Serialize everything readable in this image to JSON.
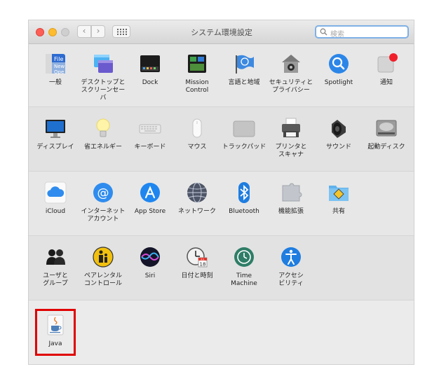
{
  "window": {
    "title": "システム環境設定",
    "search_placeholder": "検索",
    "nav": {
      "back": "‹",
      "forward": "›"
    }
  },
  "sections": [
    {
      "items": [
        {
          "label": "一般",
          "icon": "general-icon"
        },
        {
          "label": "デスクトップと\nスクリーンセーバ",
          "icon": "desktop-screensaver-icon"
        },
        {
          "label": "Dock",
          "icon": "dock-icon"
        },
        {
          "label": "Mission\nControl",
          "icon": "mission-control-icon"
        },
        {
          "label": "言語と地域",
          "icon": "language-region-icon"
        },
        {
          "label": "セキュリティと\nプライバシー",
          "icon": "security-privacy-icon"
        },
        {
          "label": "Spotlight",
          "icon": "spotlight-icon"
        },
        {
          "label": "通知",
          "icon": "notifications-icon"
        }
      ]
    },
    {
      "items": [
        {
          "label": "ディスプレイ",
          "icon": "display-icon"
        },
        {
          "label": "省エネルギー",
          "icon": "energy-saver-icon"
        },
        {
          "label": "キーボード",
          "icon": "keyboard-icon"
        },
        {
          "label": "マウス",
          "icon": "mouse-icon"
        },
        {
          "label": "トラックパッド",
          "icon": "trackpad-icon"
        },
        {
          "label": "プリンタと\nスキャナ",
          "icon": "printer-scanner-icon"
        },
        {
          "label": "サウンド",
          "icon": "sound-icon"
        },
        {
          "label": "起動ディスク",
          "icon": "startup-disk-icon"
        }
      ]
    },
    {
      "items": [
        {
          "label": "iCloud",
          "icon": "icloud-icon"
        },
        {
          "label": "インターネット\nアカウント",
          "icon": "internet-accounts-icon"
        },
        {
          "label": "App Store",
          "icon": "app-store-icon"
        },
        {
          "label": "ネットワーク",
          "icon": "network-icon"
        },
        {
          "label": "Bluetooth",
          "icon": "bluetooth-icon"
        },
        {
          "label": "機能拡張",
          "icon": "extensions-icon"
        },
        {
          "label": "共有",
          "icon": "sharing-icon"
        }
      ]
    },
    {
      "items": [
        {
          "label": "ユーザと\nグループ",
          "icon": "users-groups-icon"
        },
        {
          "label": "ペアレンタル\nコントロール",
          "icon": "parental-controls-icon"
        },
        {
          "label": "Siri",
          "icon": "siri-icon"
        },
        {
          "label": "日付と時刻",
          "icon": "date-time-icon"
        },
        {
          "label": "Time\nMachine",
          "icon": "time-machine-icon"
        },
        {
          "label": "アクセシ\nビリティ",
          "icon": "accessibility-icon"
        }
      ]
    },
    {
      "items": [
        {
          "label": "Java",
          "icon": "java-icon"
        }
      ]
    }
  ],
  "calendar_badge": "JUL",
  "calendar_day": "18",
  "highlight_color": "#e00000"
}
